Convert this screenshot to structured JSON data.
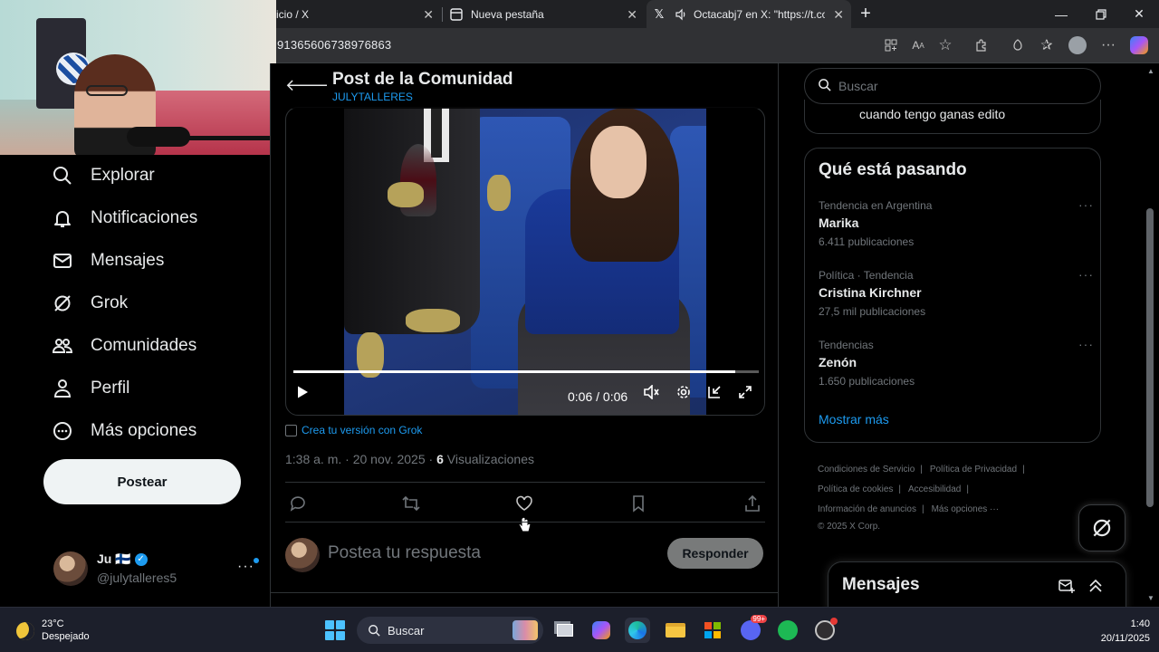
{
  "browser": {
    "tabs": [
      {
        "title": "icio / X",
        "icon": "x-logo-icon"
      },
      {
        "title": "Nueva pestaña",
        "icon": "new-tab-page-icon"
      },
      {
        "title": "Octacabj7 en X: \"https://t.co",
        "icon": "x-logo-icon",
        "audio": true
      }
    ],
    "url": "91365606738976863"
  },
  "sidebar": {
    "items": [
      {
        "label": "Explorar",
        "icon": "search-icon"
      },
      {
        "label": "Notificaciones",
        "icon": "bell-icon"
      },
      {
        "label": "Mensajes",
        "icon": "envelope-icon"
      },
      {
        "label": "Grok",
        "icon": "grok-icon"
      },
      {
        "label": "Comunidades",
        "icon": "communities-icon"
      },
      {
        "label": "Perfil",
        "icon": "person-icon"
      },
      {
        "label": "Más opciones",
        "icon": "more-circle-icon"
      }
    ],
    "post_button": "Postear",
    "account": {
      "name": "Ju 🇫🇮",
      "handle": "@julytalleres5"
    }
  },
  "post": {
    "header_title": "Post de la Comunidad",
    "header_subtitle": "JULYTALLERES",
    "video": {
      "time": "0:06 / 0:06",
      "progress": 0.95
    },
    "grok_link": "Crea tu versión con Grok",
    "timestamp": "1:38 a. m. · 20 nov. 2025 · ",
    "views_count": "6",
    "views_label": " Visualizaciones",
    "reply_placeholder": "Postea tu respuesta",
    "reply_button": "Responder"
  },
  "right": {
    "search_placeholder": "Buscar",
    "prev_card_text": "cuando tengo ganas edito",
    "trends_title": "Qué está pasando",
    "trends": [
      {
        "context": "Tendencia en Argentina",
        "name": "Marika",
        "count": "6.411 publicaciones"
      },
      {
        "context": "Política · Tendencia",
        "name": "Cristina Kirchner",
        "count": "27,5 mil publicaciones"
      },
      {
        "context": "Tendencias",
        "name": "Zenón",
        "count": "1.650 publicaciones"
      }
    ],
    "show_more": "Mostrar más",
    "footer": {
      "terms": "Condiciones de Servicio",
      "privacy": "Política de Privacidad",
      "cookies": "Política de cookies",
      "accessibility": "Accesibilidad",
      "ads": "Información de anuncios",
      "more": "Más opciones ···",
      "copyright": "© 2025 X Corp."
    },
    "messages_title": "Mensajes"
  },
  "taskbar": {
    "temp": "23°C",
    "weather": "Despejado",
    "search": "Buscar",
    "time": "1:40",
    "date": "20/11/2025",
    "discord_badge": "99+"
  },
  "colors": {
    "accent": "#1d9bf0",
    "background": "#000000",
    "muted": "#71767b"
  }
}
